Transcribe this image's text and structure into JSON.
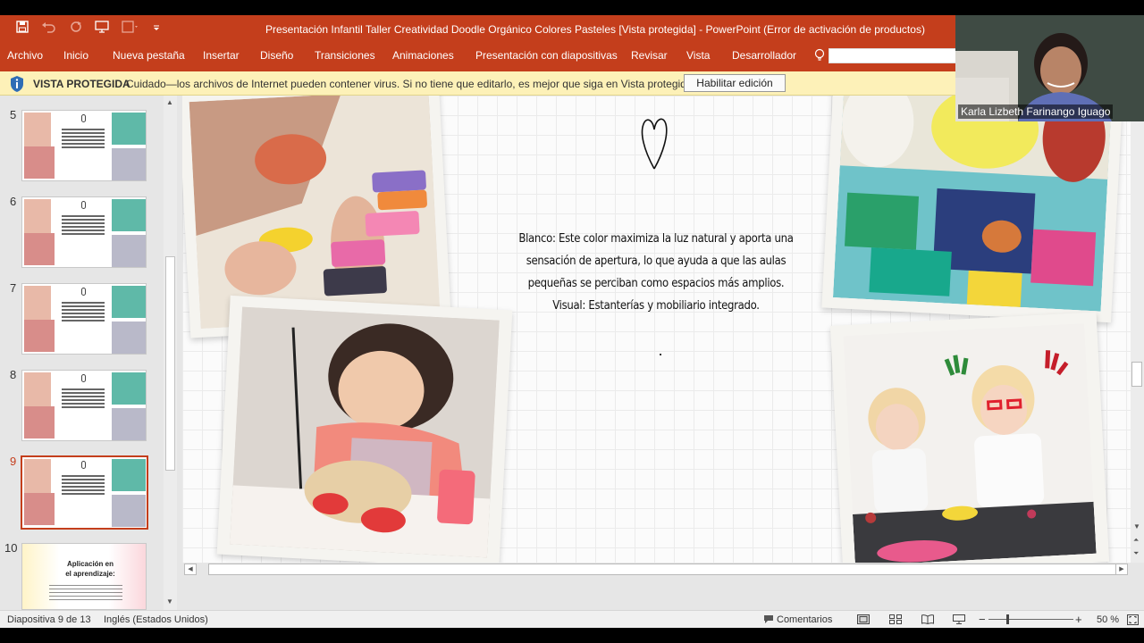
{
  "titlebar": {
    "title": "Presentación Infantil Taller Creatividad Doodle Orgánico Colores Pasteles [Vista protegida] - PowerPoint (Error de activación de productos)"
  },
  "ribbon": {
    "tabs": [
      "Archivo",
      "Inicio",
      "Nueva pestaña",
      "Insertar",
      "Diseño",
      "Transiciones",
      "Animaciones",
      "Presentación con diapositivas",
      "Revisar",
      "Vista",
      "Desarrollador"
    ],
    "search_placeholder": ""
  },
  "protected_view": {
    "label": "VISTA PROTEGIDA",
    "message": "Cuidado—los archivos de Internet pueden contener virus. Si no tiene que editarlo, es mejor que siga en Vista protegida.",
    "button": "Habilitar edición"
  },
  "video": {
    "participant_name": "Karla Lizbeth Farinango Iguago"
  },
  "thumbnails": {
    "numbers": [
      "5",
      "6",
      "7",
      "8",
      "9",
      "10"
    ],
    "selected": "9",
    "slide10_title": "Aplicación en el aprendizaje:"
  },
  "slide": {
    "lines": [
      "Blanco: Este color maximiza la luz natural y aporta una",
      "sensación de apertura, lo que ayuda a que las aulas",
      "pequeñas se perciban como espacios más amplios.",
      "Visual: Estanterías y mobiliario integrado."
    ]
  },
  "statusbar": {
    "slide_info": "Diapositiva 9 de 13",
    "language": "Inglés (Estados Unidos)",
    "comments": "Comentarios",
    "zoom": "50 %"
  },
  "colors": {
    "accent": "#c43e1c",
    "protected_bar": "#fdf1b8",
    "selected_thumb": "#c43e1c"
  }
}
